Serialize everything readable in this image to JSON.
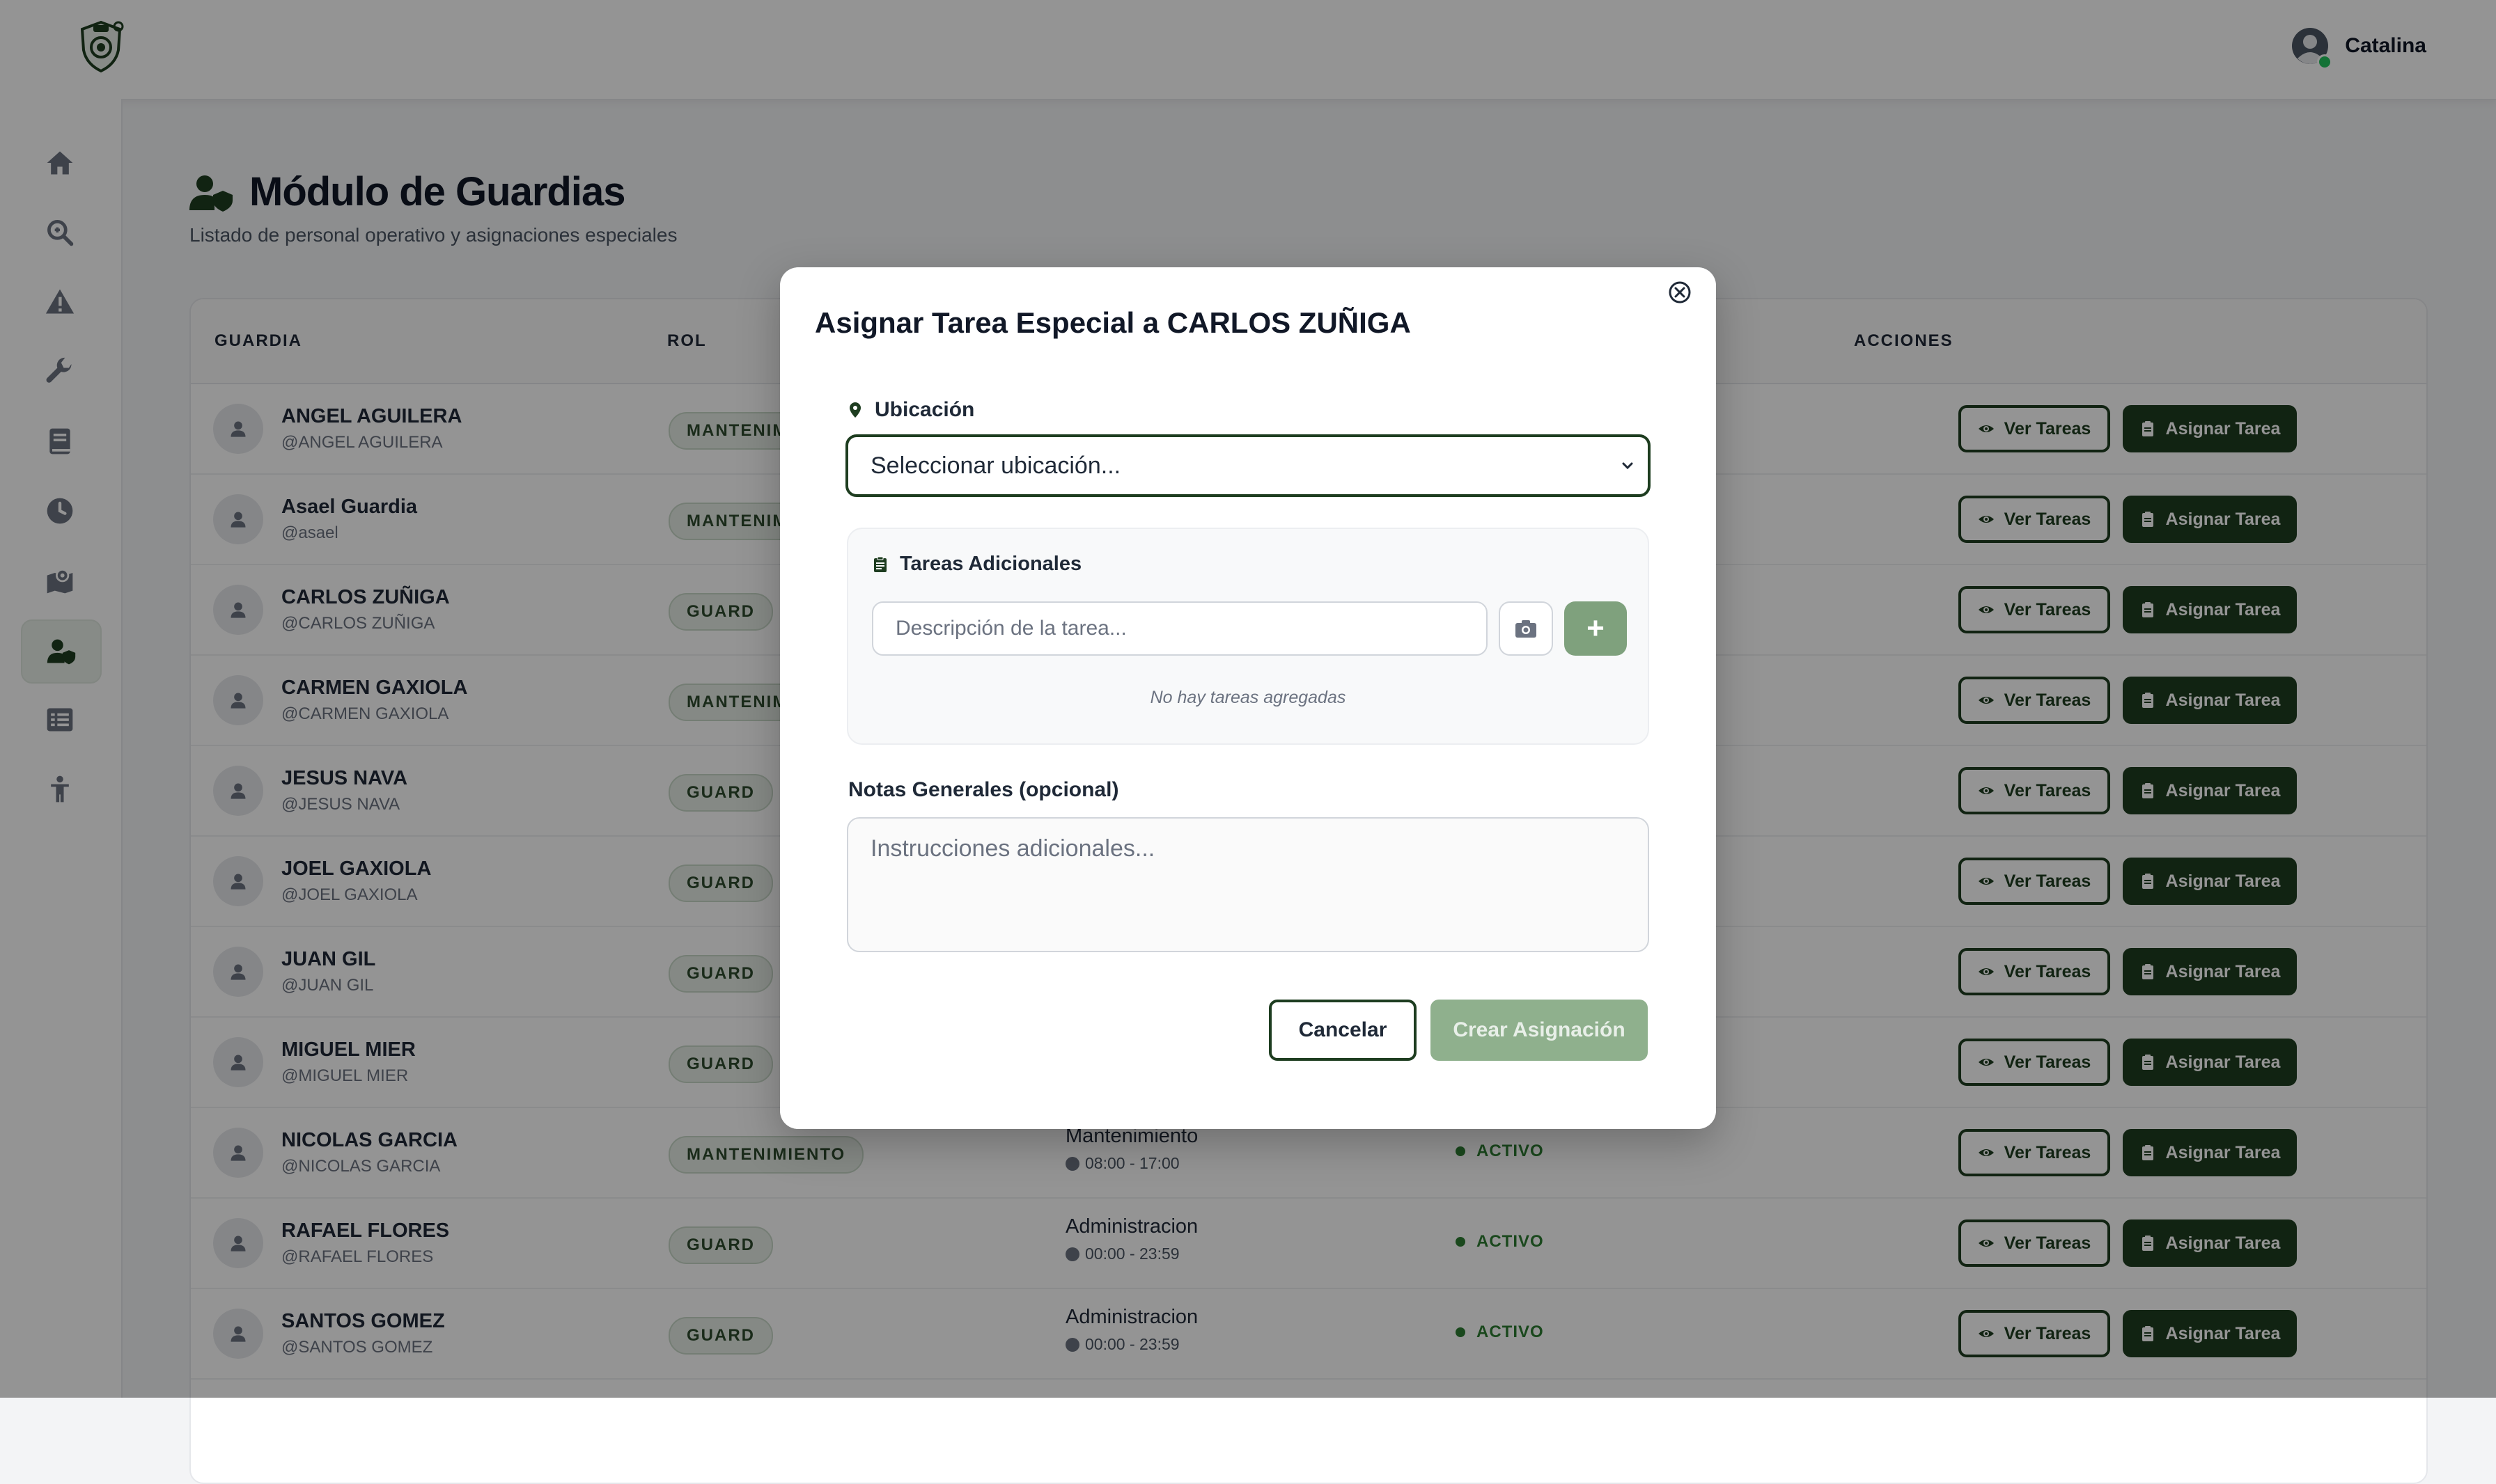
{
  "header": {
    "logo_icon": "shield-logo-icon",
    "user_name": "Catalina",
    "user_icon": "user-circle-icon",
    "online_color": "#22c55e"
  },
  "sidebar": {
    "items": [
      {
        "icon": "home-icon",
        "active": false
      },
      {
        "icon": "search-icon",
        "active": false
      },
      {
        "icon": "warning-icon",
        "active": false
      },
      {
        "icon": "wrench-icon",
        "active": false
      },
      {
        "icon": "book-icon",
        "active": false
      },
      {
        "icon": "clock-icon",
        "active": false
      },
      {
        "icon": "map-icon",
        "active": false
      },
      {
        "icon": "user-shield-icon",
        "active": true
      },
      {
        "icon": "list-icon",
        "active": false
      },
      {
        "icon": "person-icon",
        "active": false
      }
    ]
  },
  "page": {
    "title": "Módulo de Guardias",
    "subtitle": "Listado de personal operativo y asignaciones especiales"
  },
  "table": {
    "headers": {
      "guardia": "GUARDIA",
      "rol": "ROL",
      "acciones": "ACCIONES"
    },
    "btn_ver": "Ver Tareas",
    "btn_asignar": "Asignar Tarea",
    "rows": [
      {
        "name": "ANGEL AGUILERA",
        "user": "@ANGEL AGUILERA",
        "role": "MANTENIMIENTO",
        "shift": "",
        "hours": "",
        "status": ""
      },
      {
        "name": "Asael Guardia",
        "user": "@asael",
        "role": "MANTENIMIENTO",
        "shift": "",
        "hours": "",
        "status": ""
      },
      {
        "name": "CARLOS ZUÑIGA",
        "user": "@CARLOS ZUÑIGA",
        "role": "GUARD",
        "shift": "",
        "hours": "",
        "status": ""
      },
      {
        "name": "CARMEN GAXIOLA",
        "user": "@CARMEN GAXIOLA",
        "role": "MANTENIMIENTO",
        "shift": "",
        "hours": "",
        "status": ""
      },
      {
        "name": "JESUS NAVA",
        "user": "@JESUS NAVA",
        "role": "GUARD",
        "shift": "",
        "hours": "",
        "status": ""
      },
      {
        "name": "JOEL GAXIOLA",
        "user": "@JOEL GAXIOLA",
        "role": "GUARD",
        "shift": "",
        "hours": "",
        "status": ""
      },
      {
        "name": "JUAN GIL",
        "user": "@JUAN GIL",
        "role": "GUARD",
        "shift": "",
        "hours": "",
        "status": ""
      },
      {
        "name": "MIGUEL MIER",
        "user": "@MIGUEL MIER",
        "role": "GUARD",
        "shift": "",
        "hours": "",
        "status": ""
      },
      {
        "name": "NICOLAS GARCIA",
        "user": "@NICOLAS GARCIA",
        "role": "MANTENIMIENTO",
        "shift": "Mantenimiento",
        "hours": "08:00 - 17:00",
        "status": "ACTIVO"
      },
      {
        "name": "RAFAEL FLORES",
        "user": "@RAFAEL FLORES",
        "role": "GUARD",
        "shift": "Administracion",
        "hours": "00:00 - 23:59",
        "status": "ACTIVO"
      },
      {
        "name": "SANTOS GOMEZ",
        "user": "@SANTOS GOMEZ",
        "role": "GUARD",
        "shift": "Administracion",
        "hours": "00:00 - 23:59",
        "status": "ACTIVO"
      }
    ]
  },
  "modal": {
    "title": "Asignar Tarea Especial a CARLOS ZUÑIGA",
    "location_label": "Ubicación",
    "location_value": "Seleccionar ubicación...",
    "tasks_label": "Tareas Adicionales",
    "task_placeholder": "Descripción de la tarea...",
    "add_label": "+",
    "no_tasks": "No hay tareas agregadas",
    "notes_label": "Notas Generales (opcional)",
    "notes_placeholder": "Instrucciones adicionales...",
    "cancel": "Cancelar",
    "create": "Crear Asignación"
  },
  "colors": {
    "primary": "#1e3d20",
    "primary_disabled": "#8fb08d",
    "status_active": "#2e7d32"
  }
}
